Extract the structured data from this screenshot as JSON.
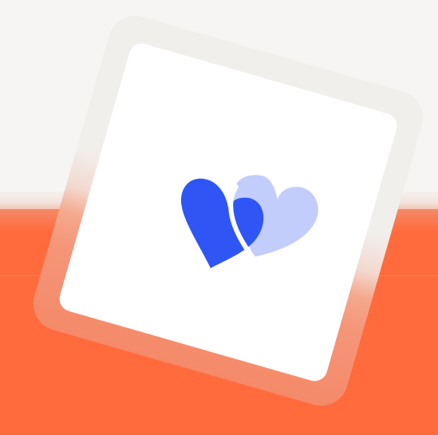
{
  "scene": {
    "background": {
      "top_color": "#f6f5f3",
      "bottom_color": "#ff6b3d"
    },
    "card": {
      "frame_color": "#f1efec",
      "surface_color": "#ffffff",
      "icon": {
        "name": "two-hearts-icon",
        "front_color": "#2f56f5",
        "back_color": "#c2cdfb",
        "overlap_color": "#2a55f4"
      }
    }
  }
}
